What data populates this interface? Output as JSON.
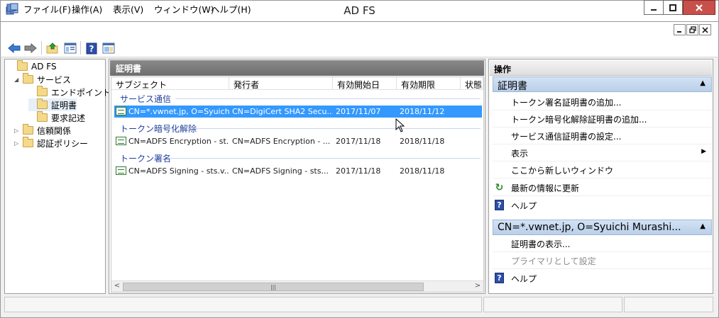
{
  "window": {
    "title": "AD FS",
    "caption_buttons": {
      "minimize": "minimize-icon",
      "maximize": "maximize-icon",
      "close": "close-icon"
    }
  },
  "menu": {
    "items": [
      "ファイル(F)",
      "操作(A)",
      "表示(V)",
      "ウィンドウ(W)",
      "ヘルプ(H)"
    ]
  },
  "toolbar": {
    "icons": [
      "back-arrow-icon",
      "forward-arrow-icon",
      "up-folder-icon",
      "show-hide-tree-icon",
      "help-icon",
      "show-hide-action-pane-icon"
    ]
  },
  "tree": {
    "items": [
      {
        "label": "AD FS",
        "level": 0,
        "expander": ""
      },
      {
        "label": "サービス",
        "level": 1,
        "expander": "◢"
      },
      {
        "label": "エンドポイント",
        "level": 2,
        "expander": ""
      },
      {
        "label": "証明書",
        "level": 2,
        "expander": "",
        "selected": true
      },
      {
        "label": "要求記述",
        "level": 2,
        "expander": ""
      },
      {
        "label": "信頼関係",
        "level": 1,
        "expander": "▷"
      },
      {
        "label": "認証ポリシー",
        "level": 1,
        "expander": "▷"
      }
    ]
  },
  "center": {
    "title": "証明書",
    "columns": [
      "サブジェクト",
      "発行者",
      "有効開始日",
      "有効期限",
      "状態"
    ],
    "groups": [
      {
        "name": "サービス通信",
        "rows": [
          {
            "subject": "CN=*.vwnet.jp, O=Syuichi ...",
            "issuer": "CN=DigiCert SHA2 Secu...",
            "start": "2017/11/07",
            "end": "2018/11/12",
            "selected": true
          }
        ]
      },
      {
        "name": "トークン暗号化解除",
        "rows": [
          {
            "subject": "CN=ADFS Encryption - st...",
            "issuer": "CN=ADFS Encryption - ...",
            "start": "2017/11/18",
            "end": "2018/11/18",
            "selected": false
          }
        ]
      },
      {
        "name": "トークン署名",
        "rows": [
          {
            "subject": "CN=ADFS Signing - sts.v...",
            "issuer": "CN=ADFS Signing - sts...",
            "start": "2017/11/18",
            "end": "2018/11/18",
            "selected": false
          }
        ]
      }
    ]
  },
  "actions": {
    "title": "操作",
    "sections": [
      {
        "name": "証明書",
        "items": [
          {
            "label": "トークン署名証明書の追加...",
            "icon": "",
            "disabled": false,
            "submenu": false
          },
          {
            "label": "トークン暗号化解除証明書の追加...",
            "icon": "",
            "disabled": false,
            "submenu": false
          },
          {
            "label": "サービス通信証明書の設定...",
            "icon": "",
            "disabled": false,
            "submenu": false
          },
          {
            "label": "表示",
            "icon": "",
            "disabled": false,
            "submenu": true
          },
          {
            "label": "ここから新しいウィンドウ",
            "icon": "",
            "disabled": false,
            "submenu": false
          },
          {
            "label": "最新の情報に更新",
            "icon": "refresh-icon",
            "disabled": false,
            "submenu": false
          },
          {
            "label": "ヘルプ",
            "icon": "help-icon",
            "disabled": false,
            "submenu": false
          }
        ]
      },
      {
        "name": "CN=*.vwnet.jp, O=Syuichi Murashi...",
        "items": [
          {
            "label": "証明書の表示...",
            "icon": "",
            "disabled": false,
            "submenu": false
          },
          {
            "label": "プライマリとして設定",
            "icon": "",
            "disabled": true,
            "submenu": false
          },
          {
            "label": "ヘルプ",
            "icon": "help-icon",
            "disabled": false,
            "submenu": false
          }
        ]
      }
    ]
  },
  "glyphs": {
    "help": "?",
    "refresh": "↻",
    "collapse": "▲",
    "submenu": "▶",
    "scroll_left": "<",
    "scroll_right": ">",
    "scroll_grip": "|||"
  }
}
